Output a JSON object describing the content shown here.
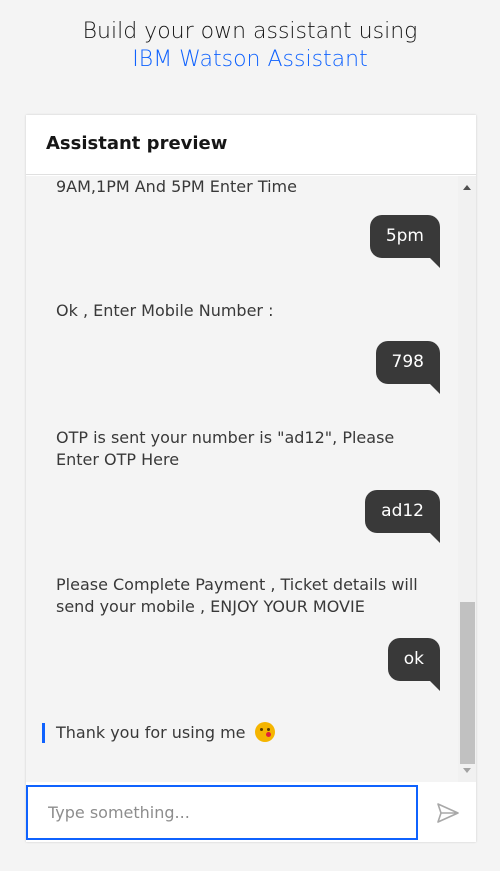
{
  "header": {
    "line1": "Build your own assistant using",
    "line2": "IBM Watson Assistant"
  },
  "panel": {
    "title": "Assistant preview"
  },
  "messages": {
    "m1": "9AM,1PM And 5PM Enter Time",
    "u1": "5pm",
    "m2": "Ok , Enter Mobile Number :",
    "u2": "798",
    "m3": "OTP is sent your number is \"ad12\", Please Enter OTP Here",
    "u3": "ad12",
    "m4": "Please Complete Payment , Ticket details will send your mobile , ENJOY YOUR MOVIE",
    "u4": "ok",
    "m5": "Thank you for using me",
    "m5_emoji": "kissing-face-emoji"
  },
  "composer": {
    "placeholder": "Type something..."
  },
  "colors": {
    "accent": "#0f62fe",
    "user_bubble": "#393939",
    "background": "#f4f4f4"
  }
}
